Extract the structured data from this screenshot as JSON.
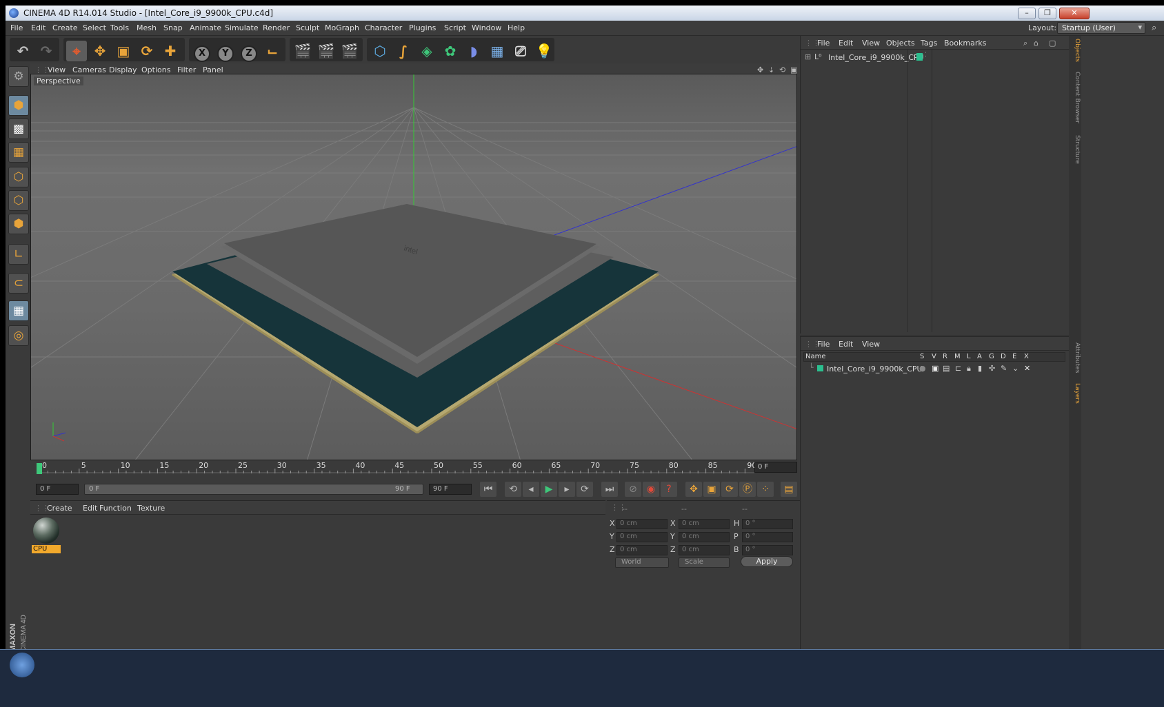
{
  "window": {
    "title": "CINEMA 4D R14.014 Studio - [Intel_Core_i9_9900k_CPU.c4d]"
  },
  "menu": [
    "File",
    "Edit",
    "Create",
    "Select",
    "Tools",
    "Mesh",
    "Snap",
    "Animate",
    "Simulate",
    "Render",
    "Sculpt",
    "MoGraph",
    "Character",
    "Plugins",
    "Script",
    "Window",
    "Help"
  ],
  "layout": {
    "label": "Layout:",
    "value": "Startup (User)"
  },
  "toolbar": {
    "axis_x": "X",
    "axis_y": "Y",
    "axis_z": "Z"
  },
  "viewport": {
    "menu": [
      "View",
      "Cameras",
      "Display",
      "Options",
      "Filter",
      "Panel"
    ],
    "label": "Perspective"
  },
  "timeline": {
    "ticks": [
      "0",
      "5",
      "10",
      "15",
      "20",
      "25",
      "30",
      "35",
      "40",
      "45",
      "50",
      "55",
      "60",
      "65",
      "70",
      "75",
      "80",
      "85",
      "90"
    ],
    "current_frame": "0 F"
  },
  "transport": {
    "start": "0 F",
    "range_start": "0 F",
    "range_end": "90 F",
    "end": "90 F"
  },
  "materials": {
    "menu": [
      "Create",
      "Edit",
      "Function",
      "Texture"
    ],
    "items": [
      {
        "name": "CPU"
      }
    ]
  },
  "coords": {
    "headers": [
      "--",
      "--",
      "--"
    ],
    "labels": [
      "X",
      "X",
      "H",
      "Y",
      "Y",
      "P",
      "Z",
      "Z",
      "B"
    ],
    "values": [
      "0 cm",
      "0 cm",
      "0 °",
      "0 cm",
      "0 cm",
      "0 °",
      "0 cm",
      "0 cm",
      "0 °"
    ],
    "mode1": "World",
    "mode2": "Scale",
    "apply": "Apply"
  },
  "objects": {
    "menu": [
      "File",
      "Edit",
      "View",
      "Objects",
      "Tags",
      "Bookmarks"
    ],
    "items": [
      {
        "name": "Intel_Core_i9_9900k_CPU",
        "color": "#2bbf8f"
      }
    ]
  },
  "layers": {
    "menu": [
      "File",
      "Edit",
      "View"
    ],
    "columns": [
      "Name",
      "S",
      "V",
      "R",
      "M",
      "L",
      "A",
      "G",
      "D",
      "E",
      "X"
    ],
    "items": [
      {
        "name": "Intel_Core_i9_9900k_CPU",
        "color": "#2bbf8f"
      }
    ]
  },
  "sidetabs": [
    "Objects",
    "Content Browser",
    "Structure",
    "Attributes",
    "Layers"
  ],
  "branding": {
    "logo": "MAXON CINEMA 4D"
  },
  "colors": {
    "accent": "#e8a43a",
    "panel": "#3a3a3a",
    "x_axis": "#c33",
    "y_axis": "#3c3",
    "z_axis": "#33c"
  }
}
